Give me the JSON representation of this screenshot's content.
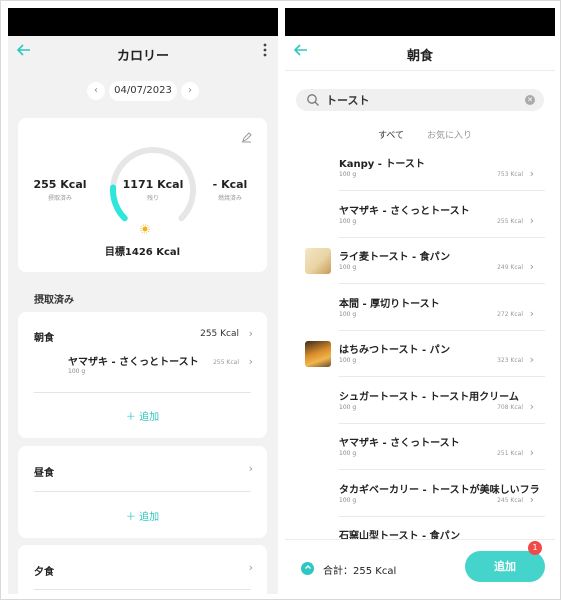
{
  "left": {
    "title": "カロリー",
    "date": "04/07/2023",
    "summary": {
      "intake_value": "255 Kcal",
      "intake_label": "摂取済み",
      "remaining_value": "1171 Kcal",
      "remaining_label": "残り",
      "burned_value": "- Kcal",
      "burned_label": "燃焼済み",
      "goal": "目標1426 Kcal",
      "progress_fraction": 0.18
    },
    "section_label": "摂取済み",
    "meals": [
      {
        "title": "朝食",
        "kcal": "255 Kcal",
        "foods": [
          {
            "name": "ヤマザキ - さくっとトースト",
            "sub": "100 g",
            "kcal": "255 Kcal"
          }
        ],
        "add_label": "＋ 追加"
      },
      {
        "title": "昼食",
        "add_label": "＋ 追加"
      },
      {
        "title": "夕食"
      }
    ]
  },
  "right": {
    "title": "朝食",
    "search_value": "トースト",
    "tabs": [
      "すべて",
      "お気に入り"
    ],
    "results": [
      {
        "name": "Kanpy - トースト",
        "sub": "100 g",
        "kcal": "753 Kcal"
      },
      {
        "name": "ヤマザキ - さくっとトースト",
        "sub": "100 g",
        "kcal": "255 Kcal"
      },
      {
        "name": "ライ麦トースト - 食パン",
        "sub": "100 g",
        "kcal": "249 Kcal"
      },
      {
        "name": "本間 - 厚切りトースト",
        "sub": "100 g",
        "kcal": "272 Kcal"
      },
      {
        "name": "はちみつトースト - パン",
        "sub": "100 g",
        "kcal": "323 Kcal"
      },
      {
        "name": "シュガートースト - トースト用クリーム",
        "sub": "100 g",
        "kcal": "708 Kcal"
      },
      {
        "name": "ヤマザキ - さくっトースト",
        "sub": "100 g",
        "kcal": "251 Kcal"
      },
      {
        "name": "タカギベーカリー - トーストが美味しいフラ",
        "sub": "100 g",
        "kcal": "245 Kcal"
      },
      {
        "name": "石窯山型トースト - 食パン",
        "sub": "",
        "kcal": ""
      }
    ],
    "total": "合計：255 Kcal",
    "add_button": "追加",
    "badge": "1"
  },
  "colors": {
    "accent": "#2ec6c1",
    "badge": "#f04a4a"
  }
}
